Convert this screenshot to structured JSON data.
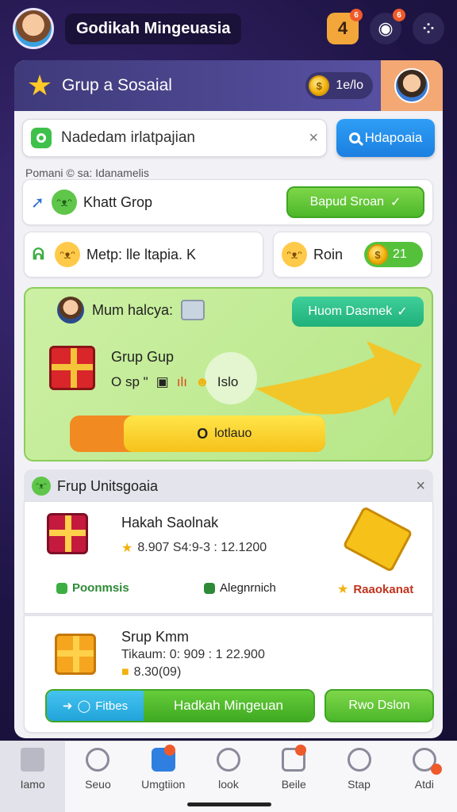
{
  "app": {
    "title": "Godikah Mingeuasia"
  },
  "top_icons": [
    {
      "name": "gift-icon",
      "glyph": "4",
      "badge": "6"
    },
    {
      "name": "settings-icon",
      "glyph": "◉",
      "badge": "6"
    },
    {
      "name": "more-icon",
      "glyph": "⁘"
    }
  ],
  "panel": {
    "title": "Grup a Sosaial",
    "coins": "1e/lo",
    "coin_symbol": "$"
  },
  "search": {
    "value": "Nadedam irlatpajian",
    "button": "Hdapoaia"
  },
  "breadcrumb": "Pomani © sa: Idanamelis",
  "row1": {
    "label": "Khatt Grop",
    "button": "Bapud Sroan"
  },
  "row2": {
    "left_label": "Metp: lle ltapia. K",
    "right_label": "Roin",
    "right_value": "21"
  },
  "promo": {
    "title": "Mum halcya:",
    "button": "Huom Dasmek",
    "group_name": "Grup Gup",
    "group_line_prefix": "O sp \"",
    "group_line_suffix": "Islo",
    "progress_label": "lotlauo",
    "progress_mark": "O",
    "progress_fraction": 0.79,
    "colors": {
      "bg": "#cdf0a4",
      "progress_track": "#f28a22",
      "progress_fill": "#f6c21a"
    }
  },
  "section": {
    "title": "Frup Unitsgoaia",
    "item1": {
      "title": "Hakah Saolnak",
      "line": "8.907 S4:9-3 : 12.1200",
      "tags": [
        "Poonmsis",
        "Alegnrnich",
        "Raaokanat"
      ]
    },
    "item2": {
      "title": "Srup Kmm",
      "line1": "Tikaum: 0: 909 : 1 22.900",
      "line2": "8.30(09)",
      "btn_left": "Fitbes",
      "btn_main": "Hadkah Mingeuan",
      "btn_small": "Rwo Dslon"
    }
  },
  "bottom_nav": [
    {
      "label": "Iamo",
      "icon": "home-icon"
    },
    {
      "label": "Seuo",
      "icon": "search-icon"
    },
    {
      "label": "Umgtiion",
      "icon": "tag-icon"
    },
    {
      "label": "look",
      "icon": "bird-icon"
    },
    {
      "label": "Beile",
      "icon": "calendar-icon"
    },
    {
      "label": "Stap",
      "icon": "chat-icon"
    },
    {
      "label": "Atdi",
      "icon": "profile-icon"
    }
  ]
}
